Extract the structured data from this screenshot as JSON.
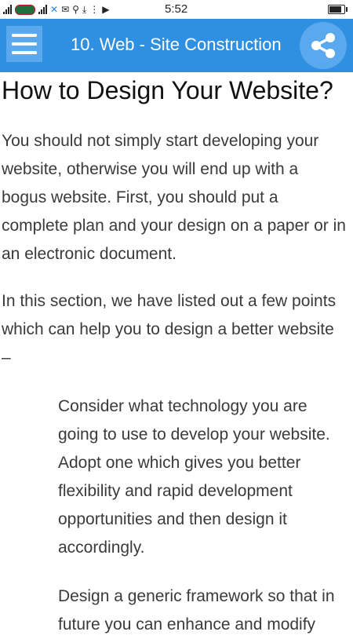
{
  "status_bar": {
    "time": "5:52",
    "battery_level": 0.9,
    "icons": [
      "signal-icon",
      "carrier-badge-icon",
      "signal-icon",
      "network-icon",
      "gmail-icon",
      "usb-icon",
      "download-icon",
      "dots-icon",
      "youtube-icon",
      "battery-icon"
    ]
  },
  "app_bar": {
    "title": "10. Web - Site Construction",
    "background": "#2f8fe0",
    "menu_icon": "hamburger-menu-icon",
    "share_icon": "share-icon"
  },
  "article": {
    "heading": "How to Design Your Website?",
    "paragraphs": [
      "You should not simply start developing your website, otherwise you will end up with a bogus website. First, you should put a complete plan and your design on a paper or in an electronic document.",
      "In this section, we have listed out a few points which can help you to design a better website –"
    ],
    "list_items": [
      "Consider what technology you are going to use to develop your website. Adopt one which gives you better flexibility and rapid development opportunities and then design it accordingly.",
      "Design a generic framework so that in future you can enhance and modify"
    ]
  }
}
